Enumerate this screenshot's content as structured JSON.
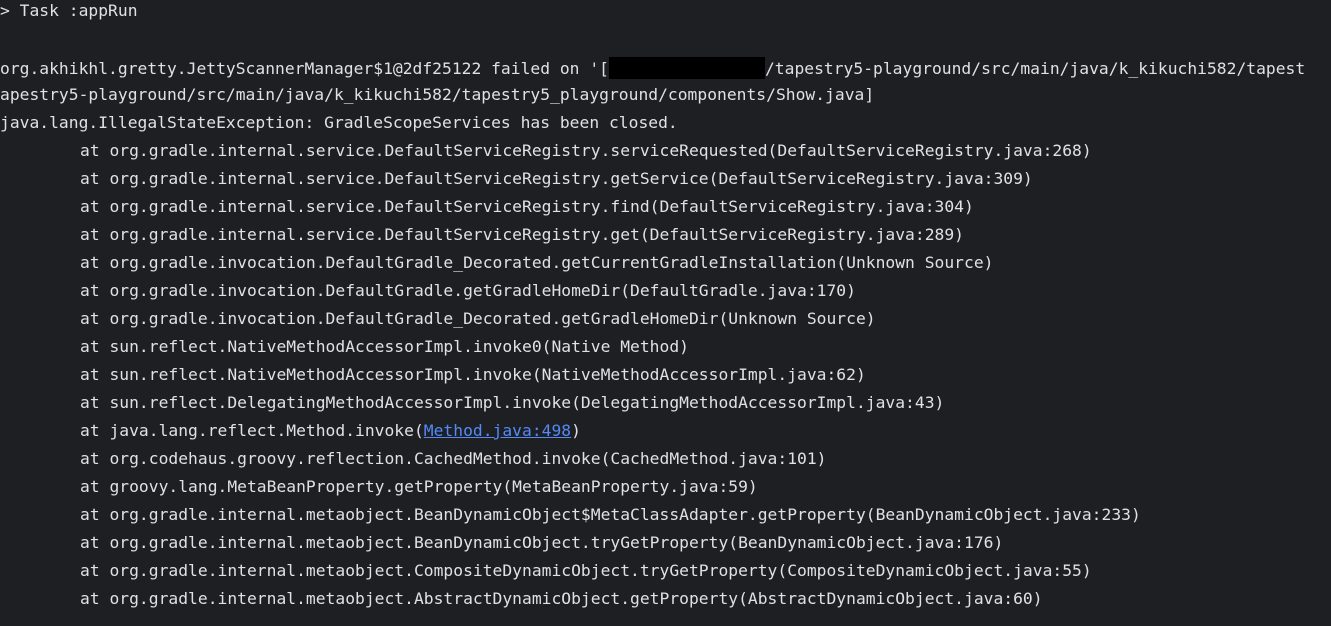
{
  "console": {
    "task_line": "> Task :appRun",
    "scanner_prefix": "org.akhikhl.gretty.JettyScannerManager$1@2df25122 failed on '[",
    "scanner_path_rest": "/tapestry5-playground/src/main/java/k_kikuchi582/tapest",
    "scanner_line2": "apestry5-playground/src/main/java/k_kikuchi582/tapestry5_playground/components/Show.java]",
    "exception": "java.lang.IllegalStateException: GradleScopeServices has been closed.",
    "frames": [
      {
        "text": "at org.gradle.internal.service.DefaultServiceRegistry.serviceRequested(DefaultServiceRegistry.java:268)"
      },
      {
        "text": "at org.gradle.internal.service.DefaultServiceRegistry.getService(DefaultServiceRegistry.java:309)"
      },
      {
        "text": "at org.gradle.internal.service.DefaultServiceRegistry.find(DefaultServiceRegistry.java:304)"
      },
      {
        "text": "at org.gradle.internal.service.DefaultServiceRegistry.get(DefaultServiceRegistry.java:289)"
      },
      {
        "text": "at org.gradle.invocation.DefaultGradle_Decorated.getCurrentGradleInstallation(Unknown Source)"
      },
      {
        "text": "at org.gradle.invocation.DefaultGradle.getGradleHomeDir(DefaultGradle.java:170)"
      },
      {
        "text": "at org.gradle.invocation.DefaultGradle_Decorated.getGradleHomeDir(Unknown Source)"
      },
      {
        "text": "at sun.reflect.NativeMethodAccessorImpl.invoke0(Native Method)"
      },
      {
        "text": "at sun.reflect.NativeMethodAccessorImpl.invoke(NativeMethodAccessorImpl.java:62)"
      },
      {
        "text": "at sun.reflect.DelegatingMethodAccessorImpl.invoke(DelegatingMethodAccessorImpl.java:43)"
      },
      {
        "prefix": "at java.lang.reflect.Method.invoke(",
        "link": "Method.java:498",
        "suffix": ")"
      },
      {
        "text": "at org.codehaus.groovy.reflection.CachedMethod.invoke(CachedMethod.java:101)"
      },
      {
        "text": "at groovy.lang.MetaBeanProperty.getProperty(MetaBeanProperty.java:59)"
      },
      {
        "text": "at org.gradle.internal.metaobject.BeanDynamicObject$MetaClassAdapter.getProperty(BeanDynamicObject.java:233)"
      },
      {
        "text": "at org.gradle.internal.metaobject.BeanDynamicObject.tryGetProperty(BeanDynamicObject.java:176)"
      },
      {
        "text": "at org.gradle.internal.metaobject.CompositeDynamicObject.tryGetProperty(CompositeDynamicObject.java:55)"
      },
      {
        "text": "at org.gradle.internal.metaobject.AbstractDynamicObject.getProperty(AbstractDynamicObject.java:60)"
      }
    ]
  },
  "colors": {
    "background": "#1e1f22",
    "text": "#dfe1e5",
    "link": "#548af7",
    "redaction": "#000000"
  }
}
